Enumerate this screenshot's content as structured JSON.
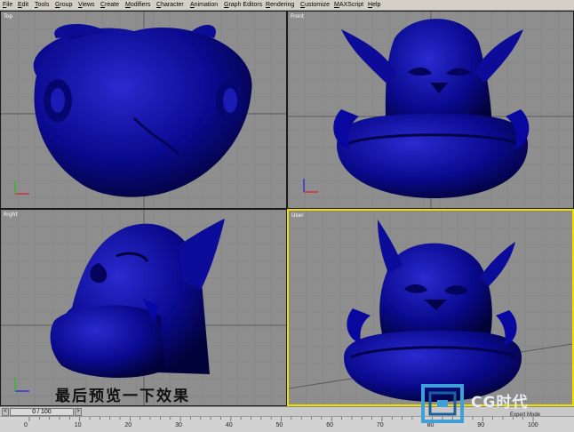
{
  "menu": {
    "items": [
      "File",
      "Edit",
      "Tools",
      "Group",
      "Views",
      "Create",
      "Modifiers",
      "Character",
      "Animation",
      "Graph Editors",
      "Rendering",
      "Customize",
      "MAXScript",
      "Help"
    ]
  },
  "viewports": {
    "top": {
      "label": "Top"
    },
    "front": {
      "label": "Front"
    },
    "right": {
      "label": "Right"
    },
    "user": {
      "label": "User"
    }
  },
  "timeline": {
    "slider_text": "0 / 100"
  },
  "ruler": {
    "ticks": [
      "0",
      "10",
      "20",
      "30",
      "40",
      "50",
      "60",
      "70",
      "80",
      "90",
      "100"
    ]
  },
  "caption": "最后预览一下效果",
  "watermark": {
    "logo_text": "CG时代",
    "sub_text": "Expert Mode"
  },
  "colors": {
    "model": "#0a0a8c",
    "viewport_bg": "#8e8e8e",
    "grid": "#7a7a7a",
    "active_border": "#f0e000"
  }
}
